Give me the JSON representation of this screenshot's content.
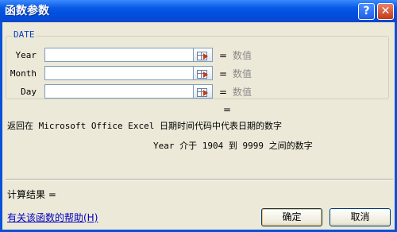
{
  "window": {
    "title": "函数参数",
    "help_btn": "?",
    "close_btn": "✕"
  },
  "group": {
    "label": "DATE",
    "args": [
      {
        "label": "Year",
        "value": "",
        "equals": "=",
        "result": "数值"
      },
      {
        "label": "Month",
        "value": "",
        "equals": "=",
        "result": "数值"
      },
      {
        "label": "Day",
        "value": "",
        "equals": "=",
        "result": "数值"
      }
    ]
  },
  "result_equals": "=",
  "description": "返回在 Microsoft Office Excel 日期时间代码中代表日期的数字",
  "arg_help": "Year  介于 1904 到 9999 之间的数字",
  "calc_result": "计算结果 =",
  "help_link": "有关该函数的帮助(H)",
  "buttons": {
    "ok": "确定",
    "cancel": "取消"
  },
  "colors": {
    "titlebar": "#0050e0",
    "dialog_bg": "#ece9d8",
    "link": "#0000c0"
  },
  "icons": {
    "ref_button": "collapse-dialog-icon"
  }
}
